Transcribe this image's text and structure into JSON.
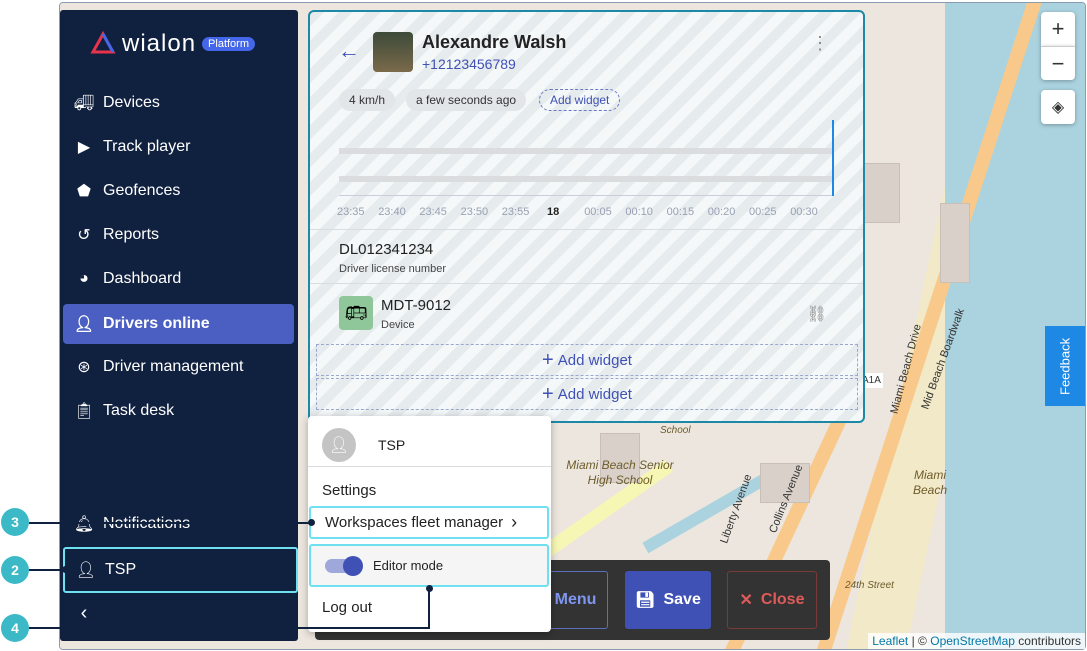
{
  "logo": {
    "word": "wialon",
    "badge": "Platform"
  },
  "sidebar": {
    "items": [
      {
        "label": "Devices",
        "icon": "truck-icon"
      },
      {
        "label": "Track player",
        "icon": "play-icon"
      },
      {
        "label": "Geofences",
        "icon": "pentagon-icon"
      },
      {
        "label": "Reports",
        "icon": "history-icon"
      },
      {
        "label": "Dashboard",
        "icon": "pie-chart-icon"
      },
      {
        "label": "Drivers online",
        "icon": "driver-icon",
        "active": true
      },
      {
        "label": "Driver management",
        "icon": "steering-wheel-icon"
      },
      {
        "label": "Task desk",
        "icon": "clipboard-icon"
      }
    ],
    "notifications": "Notifications",
    "user": "TSP",
    "collapse_icon": "chevron-left-icon"
  },
  "driver": {
    "name": "Alexandre Walsh",
    "phone": "+12123456789",
    "speed": "4 km/h",
    "last_seen": "a few seconds ago",
    "add_widget": "Add widget",
    "timeline_ticks": [
      "23:35",
      "23:40",
      "23:45",
      "23:50",
      "23:55",
      "18",
      "00:05",
      "00:10",
      "00:15",
      "00:20",
      "00:25",
      "00:30"
    ],
    "license": {
      "value": "DL012341234",
      "label": "Driver license number"
    },
    "device": {
      "value": "MDT-9012",
      "label": "Device"
    },
    "add_widget_rows": [
      "Add widget",
      "Add widget"
    ]
  },
  "user_menu": {
    "name": "TSP",
    "settings": "Settings",
    "workspaces": "Workspaces fleet manager",
    "editor_mode": "Editor mode",
    "editor_mode_on": true,
    "logout": "Log out"
  },
  "toolbar": {
    "menu": "Menu",
    "save": "Save",
    "close": "Close"
  },
  "map": {
    "feedback": "Feedback",
    "attribution_leaflet": "Leaflet",
    "attribution_sep": "| ©",
    "attribution_osm": "OpenStreetMap",
    "attribution_tail": "contributors",
    "labels": [
      "Miami Beach Senior High School",
      "School",
      "Collins Avenue",
      "Liberty Avenue",
      "Miami Beach Drive",
      "Mid Beach Boardwalk",
      "24th Street",
      "A1A",
      "Miami Beach"
    ]
  },
  "callouts": [
    "3",
    "2",
    "4"
  ],
  "colors": {
    "sidebar": "#10203f",
    "accent": "#3f51b5",
    "active": "#4a5fc1",
    "callout": "#3bb9c6",
    "highlight": "#6ee0f0"
  }
}
